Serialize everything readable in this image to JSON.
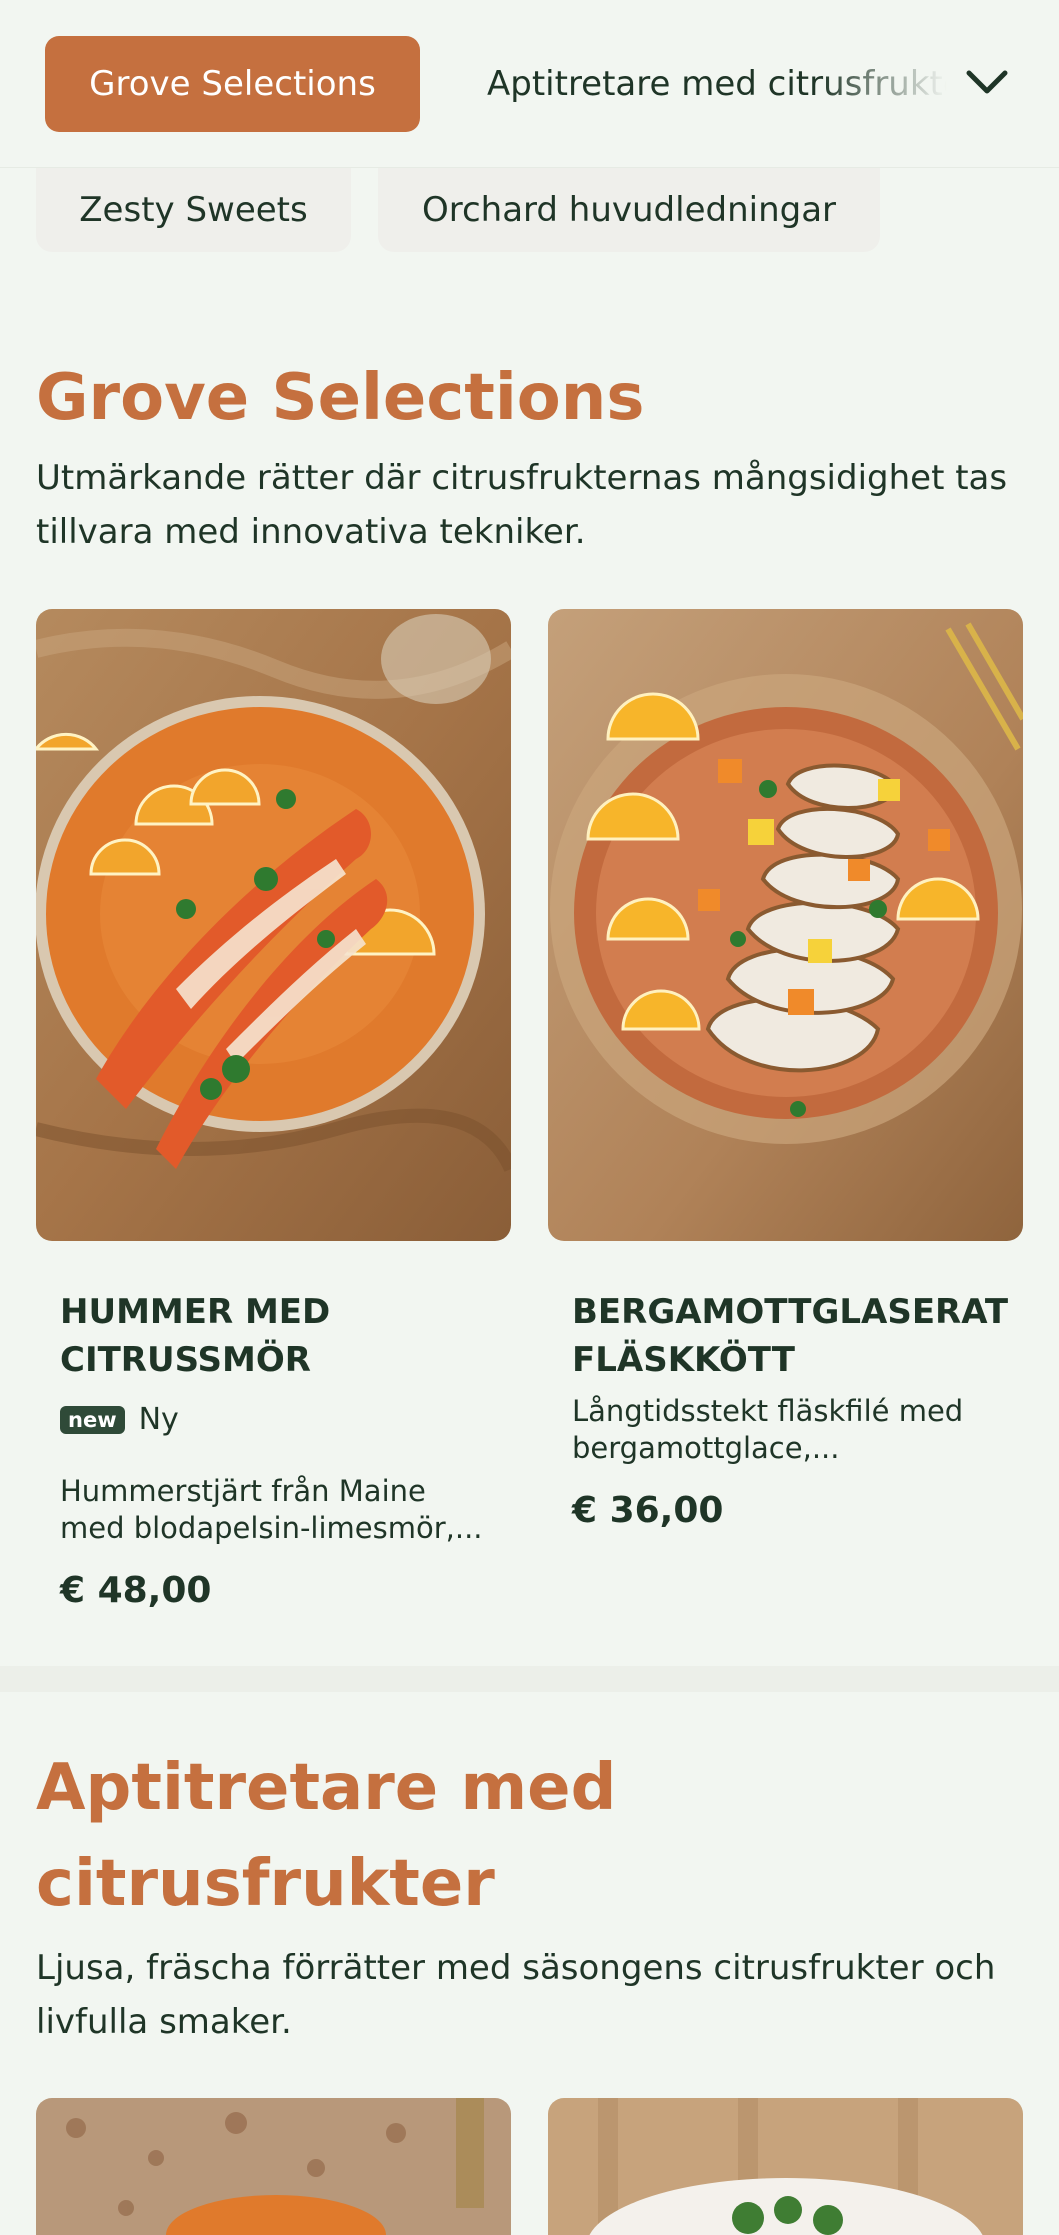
{
  "nav": {
    "active_tab": "Grove Selections",
    "next_tab": "Aptitretare med citrusfrukter",
    "chips": [
      "Zesty Sweets",
      "Orchard huvudledningar"
    ]
  },
  "sections": [
    {
      "title": "Grove Selections",
      "description": "Utmärkande rätter där citrusfrukternas mångsidighet tas tillvara med innovativa tekniker.",
      "items": [
        {
          "name": "Hummer med citrussmör",
          "badge": "new",
          "badge_label": "Ny",
          "description": "Hummerstjärt från Maine med blodapelsin-limesmör,...",
          "price": "€ 48,00",
          "image_icon": "lobster-dish-image"
        },
        {
          "name": "Bergamottglaserat fläskkött",
          "description": "Långtidsstekt fläskfilé med bergamottglace,...",
          "price": "€ 36,00",
          "image_icon": "pork-dish-image"
        }
      ]
    },
    {
      "title": "Aptitretare med citrusfrukter",
      "description": "Ljusa, fräscha förrätter med säsongens citrusfrukter och livfulla smaker."
    }
  ],
  "colors": {
    "accent": "#c5703f",
    "text": "#1f3527",
    "background": "#f2f6f1"
  }
}
